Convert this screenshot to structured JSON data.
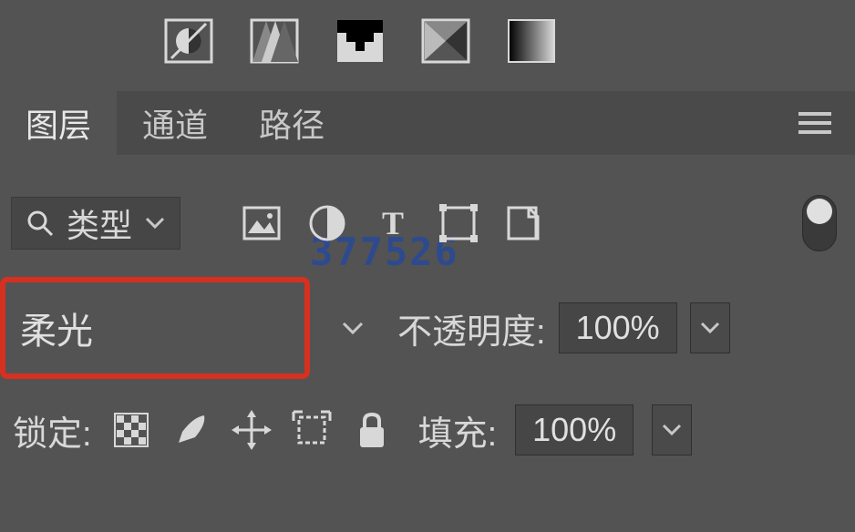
{
  "watermark": "377526",
  "tabs": {
    "layers": "图层",
    "channels": "通道",
    "paths": "路径"
  },
  "filter": {
    "type_label": "类型"
  },
  "blend": {
    "mode": "柔光",
    "opacity_label": "不透明度:",
    "opacity_value": "100%"
  },
  "lock": {
    "label": "锁定:",
    "fill_label": "填充:",
    "fill_value": "100%"
  }
}
